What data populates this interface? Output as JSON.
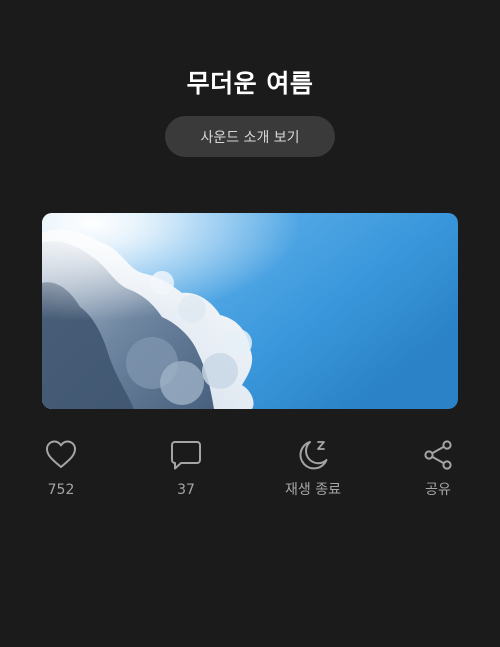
{
  "header": {
    "title": "무더운 여름"
  },
  "intro_button": {
    "label": "사운드 소개 보기"
  },
  "hero_image": {
    "subject": "sunlit-clouds-blue-sky"
  },
  "actions": {
    "like": {
      "icon": "heart-icon",
      "label": "752"
    },
    "comment": {
      "icon": "comment-icon",
      "label": "37"
    },
    "sleep_timer": {
      "icon": "moon-zz-icon",
      "label": "재생 종료"
    },
    "share": {
      "icon": "share-icon",
      "label": "공유"
    }
  },
  "colors": {
    "background": "#1b1b1b",
    "button_bg": "#3a3a3a",
    "icon": "#a5a5a5",
    "sky": "#3d9be0"
  }
}
